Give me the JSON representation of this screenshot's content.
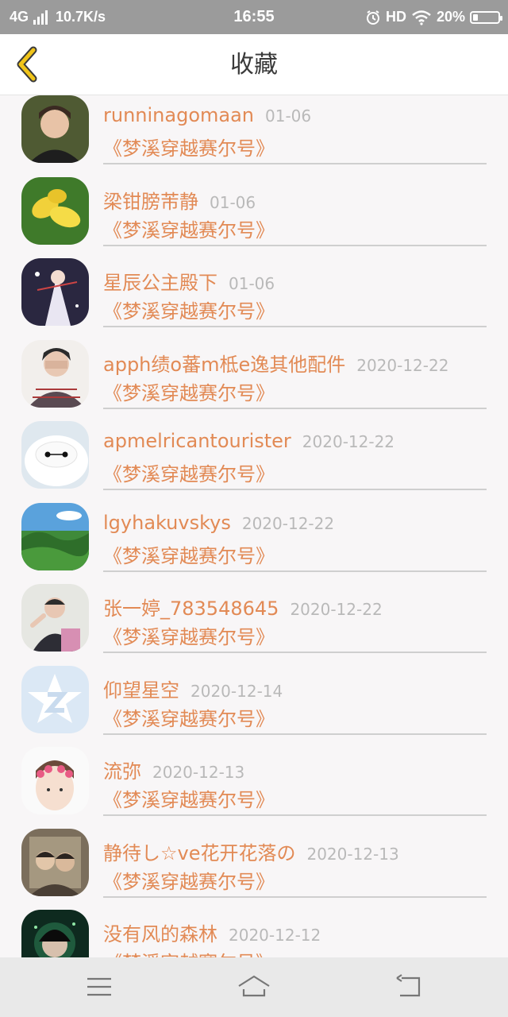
{
  "status_bar": {
    "network": "4G",
    "speed": "10.7K/s",
    "time": "16:55",
    "hd": "HD",
    "battery": "20%",
    "battery_level": 0.2
  },
  "header": {
    "title": "收藏",
    "back_icon": "chevron-left-icon",
    "accent": "#f0c419"
  },
  "colors": {
    "accent_text": "#e28a55",
    "date_text": "#b9b9b9"
  },
  "favorites": [
    {
      "user": "runninagomaan",
      "date": "01-06",
      "title": "《梦溪穿越赛尔号》"
    },
    {
      "user": "梁钳膀芾静",
      "date": "01-06",
      "title": "《梦溪穿越赛尔号》"
    },
    {
      "user": "星辰公主殿下",
      "date": "01-06",
      "title": "《梦溪穿越赛尔号》"
    },
    {
      "user": "apph绩o蕃m柢e逸其他配件",
      "date": "2020-12-22",
      "title": "《梦溪穿越赛尔号》"
    },
    {
      "user": "apmelricantourister",
      "date": "2020-12-22",
      "title": "《梦溪穿越赛尔号》"
    },
    {
      "user": "lgyhakuvskys",
      "date": "2020-12-22",
      "title": "《梦溪穿越赛尔号》"
    },
    {
      "user": "张一婷_783548645",
      "date": "2020-12-22",
      "title": "《梦溪穿越赛尔号》"
    },
    {
      "user": "仰望星空",
      "date": "2020-12-14",
      "title": "《梦溪穿越赛尔号》"
    },
    {
      "user": "流弥",
      "date": "2020-12-13",
      "title": "《梦溪穿越赛尔号》"
    },
    {
      "user": "静待し☆ve花开花落の",
      "date": "2020-12-13",
      "title": "《梦溪穿越赛尔号》"
    },
    {
      "user": "没有风的森林",
      "date": "2020-12-12",
      "title": "《梦溪穿越赛尔号》"
    }
  ],
  "nav": {
    "menu_icon": "menu-icon",
    "home_icon": "home-icon",
    "back_icon": "back-icon"
  }
}
